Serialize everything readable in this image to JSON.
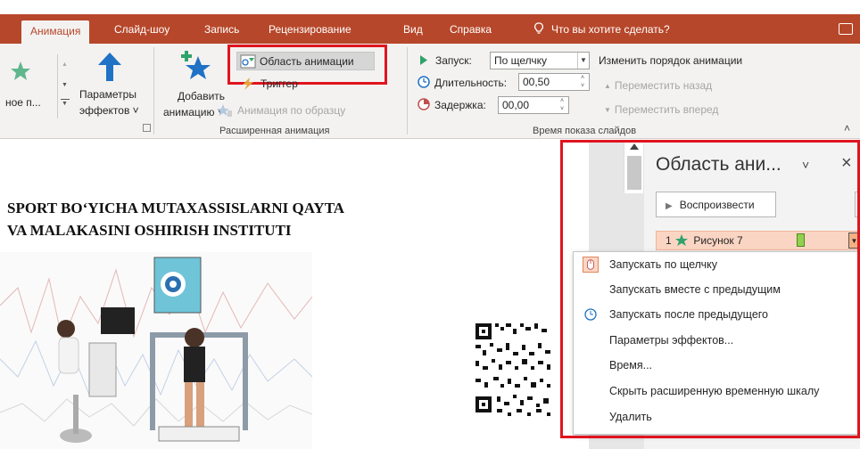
{
  "tabs": [
    {
      "label": "Анимация",
      "active": true
    },
    {
      "label": "Слайд-шоу"
    },
    {
      "label": "Запись"
    },
    {
      "label": "Рецензирование"
    },
    {
      "label": "Вид"
    },
    {
      "label": "Справка"
    }
  ],
  "search_placeholder": "Что вы хотите сделать?",
  "ribbon": {
    "effect_name_partial": "ное п...",
    "effect_params": {
      "line1": "Параметры",
      "line2": "эффектов ˅"
    },
    "add_animation": {
      "line1": "Добавить",
      "line2": "анимацию ˅"
    },
    "animation_pane": "Область анимации",
    "trigger": "Триггер",
    "animation_painter": "Анимация по образцу",
    "advanced_group_label": "Расширенная анимация",
    "start_label": "Запуск:",
    "start_value": "По щелчку",
    "duration_label": "Длительность:",
    "duration_value": "00,50",
    "delay_label": "Задержка:",
    "delay_value": "00,00",
    "reorder_label": "Изменить порядок анимации",
    "move_earlier": "Переместить назад",
    "move_later": "Переместить вперед",
    "timing_group_label": "Время показа слайдов"
  },
  "slide": {
    "title_line1": "SPORT BO‘YICHA MUTAXASSISLARNI  QAYTA",
    "title_line2": "VA MALAKASINI OSHIRISH INSTITUTI"
  },
  "animation_pane": {
    "title": "Область ани...",
    "play_button": "Воспроизвести",
    "item_number": "1",
    "item_label": "Рисунок 7"
  },
  "context_menu": [
    {
      "label": "Запускать по щелчку",
      "icon": "mouse-click-icon",
      "checked": true
    },
    {
      "label": "Запускать вместе с предыдущим",
      "icon": "",
      "checked": false
    },
    {
      "label": "Запускать после предыдущего",
      "icon": "clock-icon",
      "checked": false
    },
    {
      "label": "Параметры эффектов...",
      "icon": "",
      "checked": false
    },
    {
      "label": "Время...",
      "icon": "",
      "checked": false
    },
    {
      "label": "Скрыть расширенную временную шкалу",
      "icon": "",
      "checked": false
    },
    {
      "label": "Удалить",
      "icon": "",
      "checked": false
    }
  ],
  "colors": {
    "accent": "#b7472a",
    "highlight_box": "#e0141e",
    "star_green": "#2ea36b",
    "arrow_blue": "#1f72c4",
    "timing_bar": "#92d050",
    "selected_item": "#fbd5c3"
  }
}
